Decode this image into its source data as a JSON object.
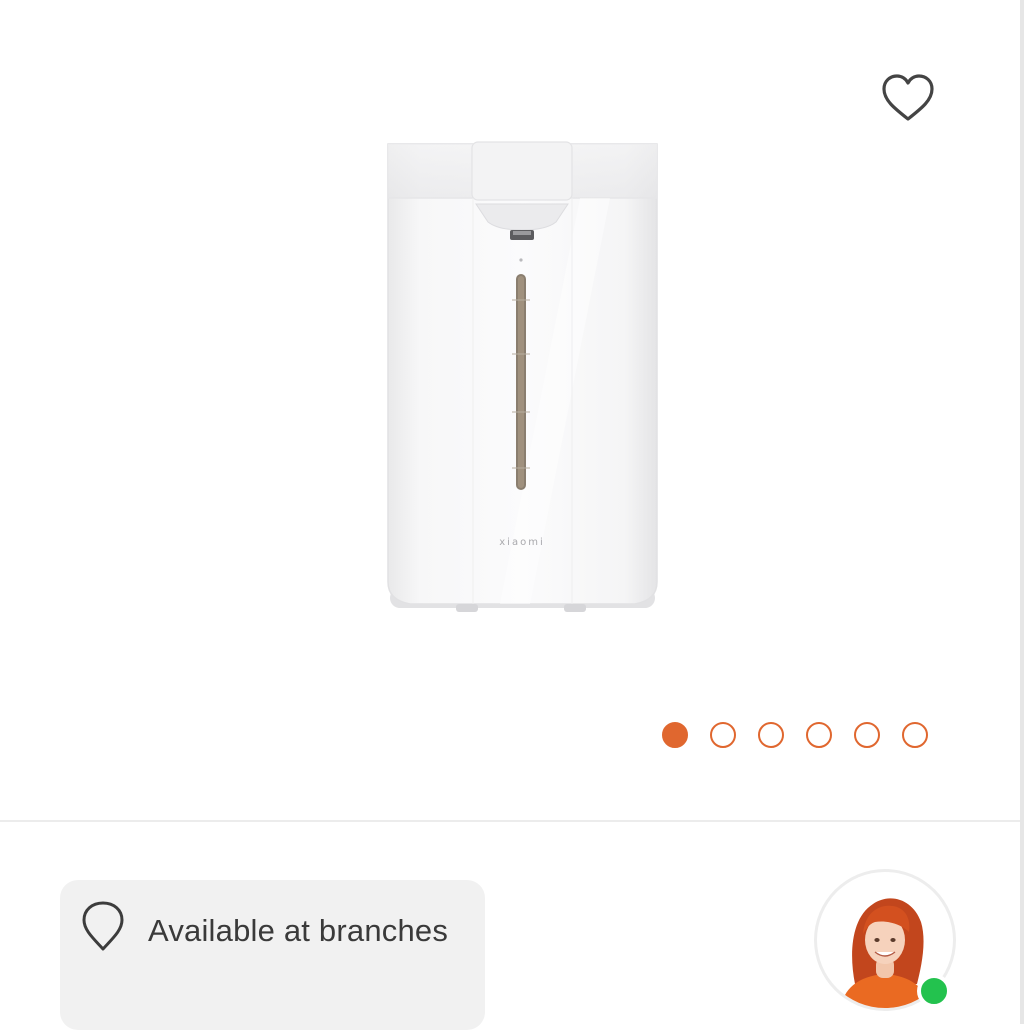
{
  "gallery": {
    "product_image_icon": "water-dispenser-image",
    "brand_mark": "xiaomi",
    "favorite_icon": "heart-outline-icon",
    "slide_count": 6,
    "active_slide": 1
  },
  "availability": {
    "icon": "location-pin-icon",
    "label": "Available at branches"
  },
  "assistant": {
    "icon": "support-agent-avatar",
    "status": "online"
  },
  "colors": {
    "accent": "#e0672f",
    "online": "#23c24e",
    "card_bg": "#f1f1f1",
    "text": "#3a3a3a"
  }
}
